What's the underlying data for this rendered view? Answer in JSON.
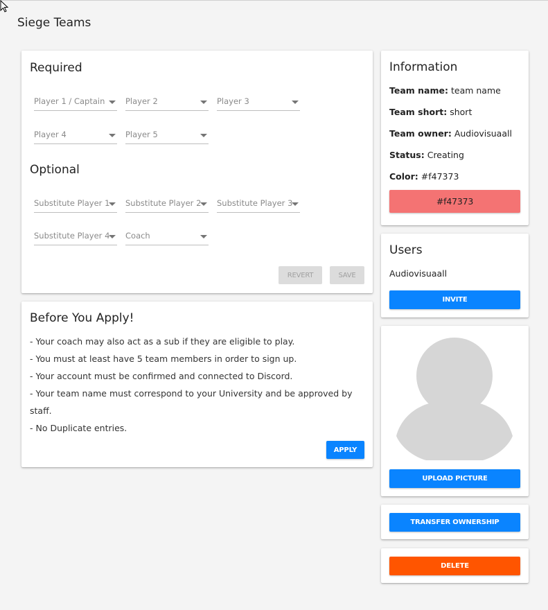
{
  "page": {
    "title": "Siege Teams"
  },
  "required": {
    "heading": "Required",
    "fields": [
      "Player 1 / Captain",
      "Player 2",
      "Player 3",
      "Player 4",
      "Player 5"
    ]
  },
  "optional": {
    "heading": "Optional",
    "fields": [
      "Substitute Player 1",
      "Substitute Player 2",
      "Substitute Player 3",
      "Substitute Player 4",
      "Coach"
    ]
  },
  "form_actions": {
    "revert_label": "REVERT",
    "save_label": "SAVE"
  },
  "rules": {
    "heading": "Before You Apply!",
    "lines": [
      "- Your coach may also act as a sub if they are eligible to play.",
      "- You must at least have 5 team members in order to sign up.",
      "- Your account must be confirmed and connected to Discord.",
      "- Your team name must correspond to your University and be approved by",
      "staff.",
      "- No Duplicate entries."
    ],
    "apply_label": "APPLY"
  },
  "information": {
    "heading": "Information",
    "team_name_label": "Team name:",
    "team_name": "team name",
    "team_short_label": "Team short:",
    "team_short": "short",
    "team_owner_label": "Team owner:",
    "team_owner": "Audiovisuaall",
    "status_label": "Status:",
    "status": "Creating",
    "color_label": "Color:",
    "color": "#f47373",
    "color_swatch": "#f47373"
  },
  "users": {
    "heading": "Users",
    "members": [
      "Audiovisuaall"
    ],
    "invite_label": "INVITE"
  },
  "picture": {
    "upload_label": "UPLOAD PICTURE",
    "avatar_icon": "user-avatar-icon"
  },
  "ownership": {
    "transfer_label": "TRANSFER OWNERSHIP"
  },
  "danger": {
    "delete_label": "DELETE"
  },
  "colors": {
    "accent": "#0a84ff",
    "danger": "#ff5500",
    "team_color": "#f47373"
  }
}
